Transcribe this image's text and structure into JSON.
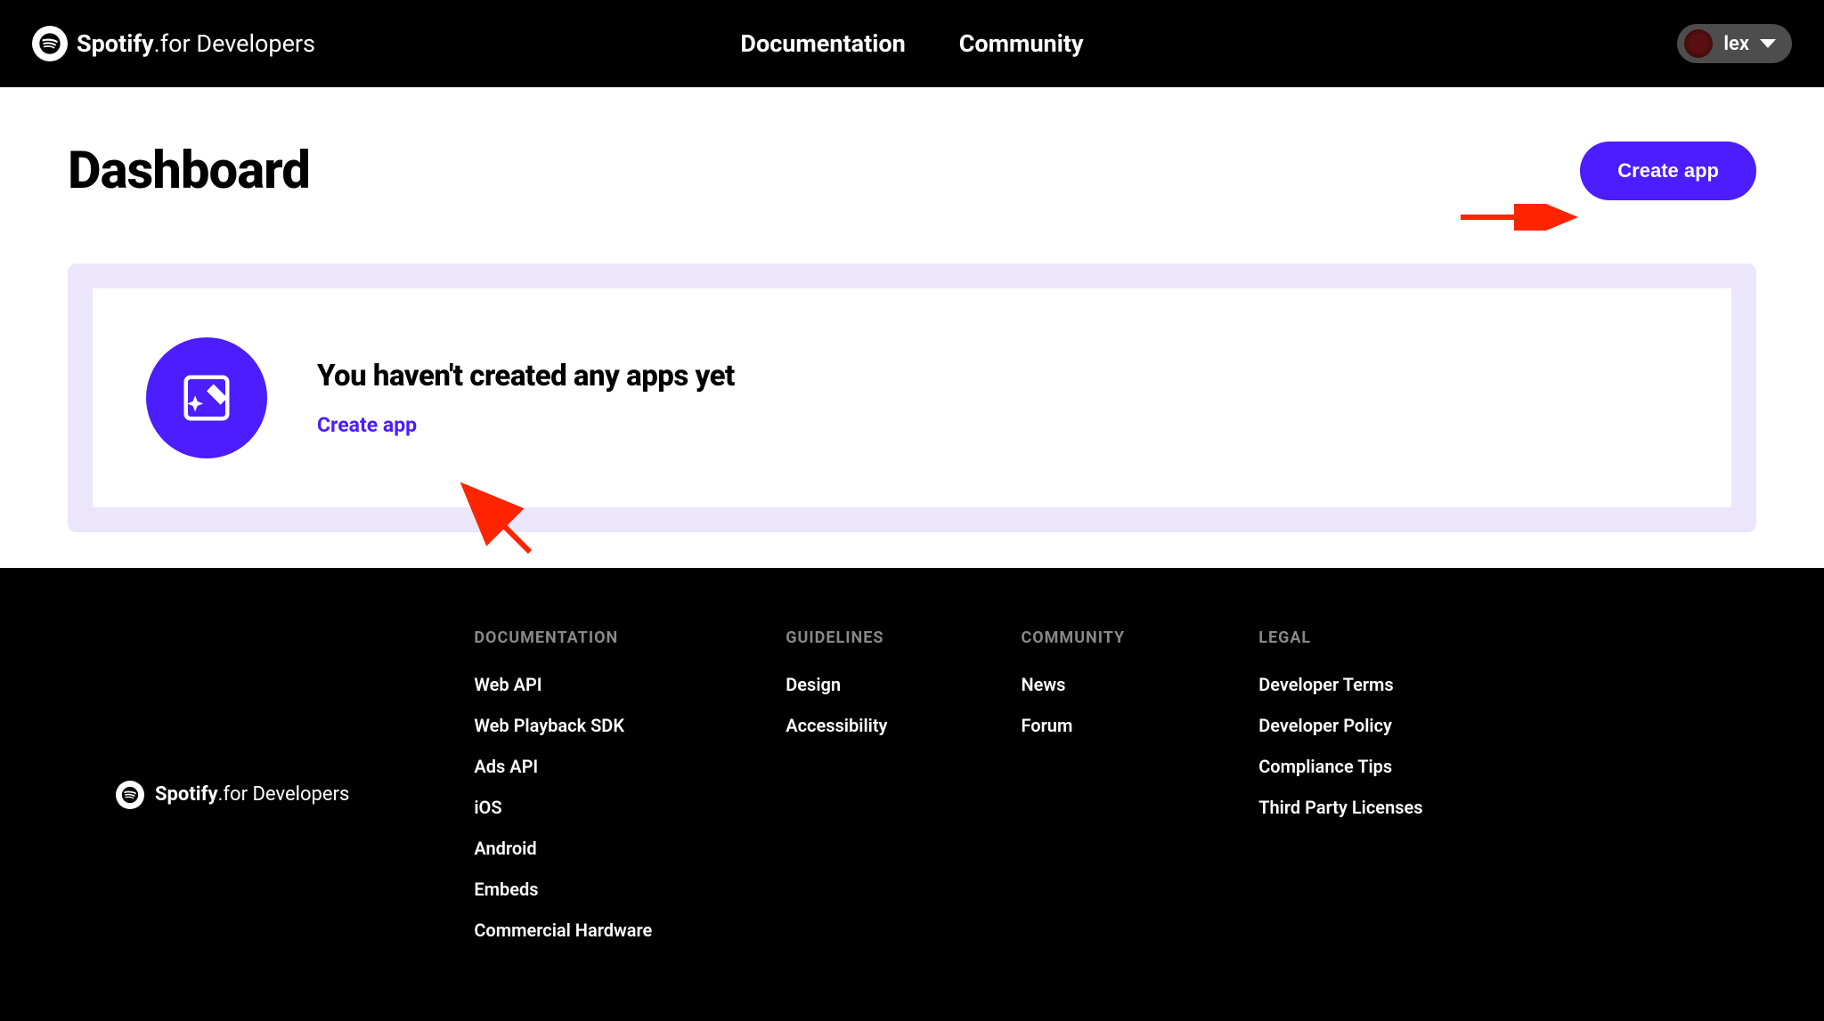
{
  "brand": {
    "name": "Spotify",
    "suffix": "for Developers"
  },
  "nav": {
    "documentation": "Documentation",
    "community": "Community"
  },
  "user": {
    "name": "lex"
  },
  "page": {
    "title": "Dashboard",
    "create_app_btn": "Create app"
  },
  "empty_state": {
    "heading": "You haven't created any apps yet",
    "link": "Create app"
  },
  "footer": {
    "columns": [
      {
        "title": "DOCUMENTATION",
        "links": [
          "Web API",
          "Web Playback SDK",
          "Ads API",
          "iOS",
          "Android",
          "Embeds",
          "Commercial Hardware"
        ]
      },
      {
        "title": "GUIDELINES",
        "links": [
          "Design",
          "Accessibility"
        ]
      },
      {
        "title": "COMMUNITY",
        "links": [
          "News",
          "Forum"
        ]
      },
      {
        "title": "LEGAL",
        "links": [
          "Developer Terms",
          "Developer Policy",
          "Compliance Tips",
          "Third Party Licenses"
        ]
      }
    ]
  }
}
